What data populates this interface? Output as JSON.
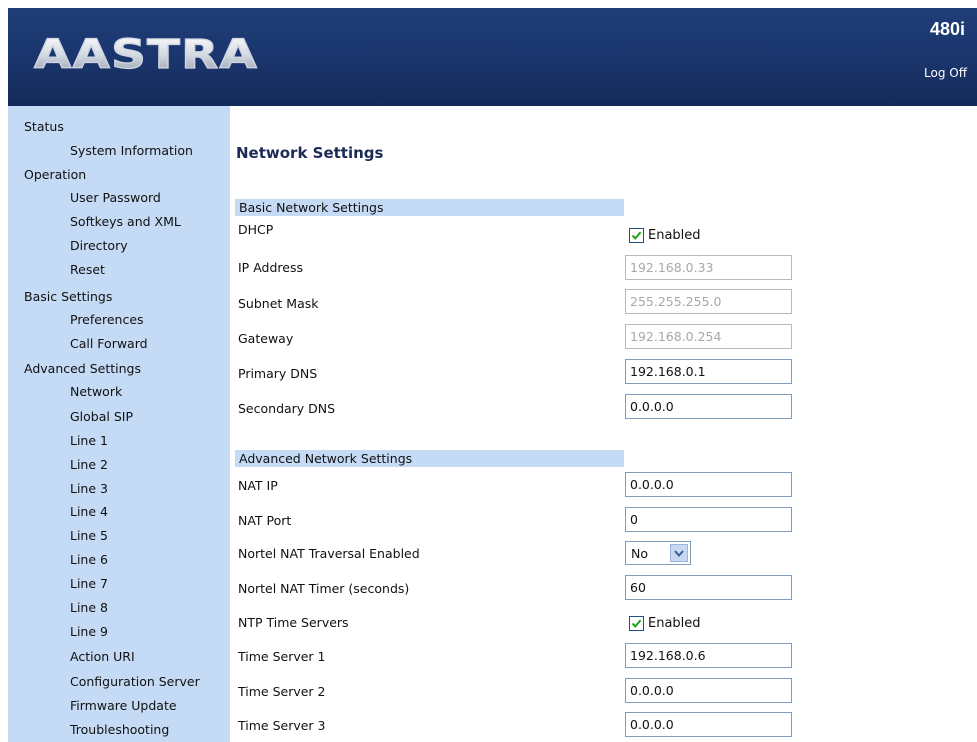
{
  "header": {
    "brand": "AASTRA",
    "model": "480i",
    "log_off": "Log Off",
    "colors": {
      "header_bg": "#1a356c",
      "sidebar_bg": "#c4daf5",
      "title": "#1a2b55"
    }
  },
  "sidebar": {
    "items": [
      {
        "label": "Status",
        "level": "section"
      },
      {
        "label": "System Information",
        "level": "sub"
      },
      {
        "label": "Operation",
        "level": "section"
      },
      {
        "label": "User Password",
        "level": "sub"
      },
      {
        "label": "Softkeys and XML",
        "level": "sub"
      },
      {
        "label": "Directory",
        "level": "sub"
      },
      {
        "label": "Reset",
        "level": "sub"
      },
      {
        "label": "Basic Settings",
        "level": "section"
      },
      {
        "label": "Preferences",
        "level": "sub"
      },
      {
        "label": "Call Forward",
        "level": "sub"
      },
      {
        "label": "Advanced Settings",
        "level": "section"
      },
      {
        "label": "Network",
        "level": "sub"
      },
      {
        "label": "Global SIP",
        "level": "sub"
      },
      {
        "label": "Line 1",
        "level": "sub"
      },
      {
        "label": "Line 2",
        "level": "sub"
      },
      {
        "label": "Line 3",
        "level": "sub"
      },
      {
        "label": "Line 4",
        "level": "sub"
      },
      {
        "label": "Line 5",
        "level": "sub"
      },
      {
        "label": "Line 6",
        "level": "sub"
      },
      {
        "label": "Line 7",
        "level": "sub"
      },
      {
        "label": "Line 8",
        "level": "sub"
      },
      {
        "label": "Line 9",
        "level": "sub"
      },
      {
        "label": "Action URI",
        "level": "sub"
      },
      {
        "label": "Configuration Server",
        "level": "sub"
      },
      {
        "label": "Firmware Update",
        "level": "sub"
      },
      {
        "label": "Troubleshooting",
        "level": "sub"
      }
    ]
  },
  "main": {
    "title": "Network Settings",
    "basic": {
      "heading": "Basic Network Settings",
      "dhcp_label": "DHCP",
      "dhcp_check_label": "Enabled",
      "dhcp_checked": true,
      "ip_label": "IP Address",
      "ip_value": "192.168.0.33",
      "subnet_label": "Subnet Mask",
      "subnet_value": "255.255.255.0",
      "gateway_label": "Gateway",
      "gateway_value": "192.168.0.254",
      "primary_dns_label": "Primary DNS",
      "primary_dns_value": "192.168.0.1",
      "secondary_dns_label": "Secondary DNS",
      "secondary_dns_value": "0.0.0.0"
    },
    "advanced": {
      "heading": "Advanced Network Settings",
      "nat_ip_label": "NAT IP",
      "nat_ip_value": "0.0.0.0",
      "nat_port_label": "NAT Port",
      "nat_port_value": "0",
      "nortel_enabled_label": "Nortel NAT Traversal Enabled",
      "nortel_enabled_value": "No",
      "nortel_timer_label": "Nortel NAT Timer (seconds)",
      "nortel_timer_value": "60",
      "ntp_label": "NTP Time Servers",
      "ntp_check_label": "Enabled",
      "ntp_checked": true,
      "ts1_label": "Time Server 1",
      "ts1_value": "192.168.0.6",
      "ts2_label": "Time Server 2",
      "ts2_value": "0.0.0.0",
      "ts3_label": "Time Server 3",
      "ts3_value": "0.0.0.0"
    }
  }
}
